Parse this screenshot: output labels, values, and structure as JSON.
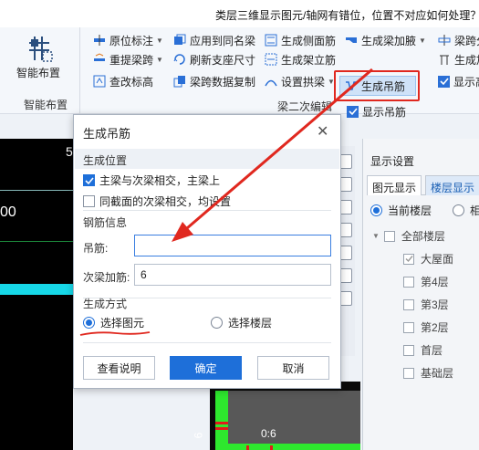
{
  "title_question": "类层三维显示图元/轴网有错位，位置不对应如何处理？",
  "colors": {
    "accent": "#1e6fd9",
    "highlight": "#e0281f",
    "green": "#2ee82e",
    "cyan": "#17d8e8"
  },
  "ribbon": {
    "smart_layout": {
      "label": "智能布置",
      "group_label": "智能布置",
      "icon": "grid-layout-icon"
    },
    "beam_group_label": "梁二次编辑",
    "items": [
      {
        "label": "原位标注",
        "icon": "in-place-annotation-icon",
        "dropdown": true
      },
      {
        "label": "重提梁跨",
        "icon": "re-extract-span-icon",
        "dropdown": true
      },
      {
        "label": "查改标高",
        "icon": "edit-elevation-icon",
        "dropdown": false
      },
      {
        "label": "应用到同名梁",
        "icon": "apply-same-name-icon",
        "dropdown": false
      },
      {
        "label": "刷新支座尺寸",
        "icon": "refresh-support-icon",
        "dropdown": false
      },
      {
        "label": "梁跨数据复制",
        "icon": "copy-span-data-icon",
        "dropdown": false
      },
      {
        "label": "生成侧面筋",
        "icon": "side-rebar-icon",
        "dropdown": false
      },
      {
        "label": "生成架立筋",
        "icon": "erection-rebar-icon",
        "dropdown": false
      },
      {
        "label": "设置拱梁",
        "icon": "arch-beam-icon",
        "dropdown": true
      },
      {
        "label": "生成梁加腋",
        "icon": "haunch-icon",
        "dropdown": true
      },
      {
        "label": "生成吊筋",
        "icon": "hanger-rebar-icon",
        "dropdown": false
      },
      {
        "label": "显示吊筋",
        "icon": "checkbox-checked-icon",
        "dropdown": false
      },
      {
        "label": "梁跨分",
        "icon": "span-split-icon",
        "dropdown": false
      },
      {
        "label": "生成加",
        "icon": "generate-add-icon",
        "dropdown": false
      },
      {
        "label": "显示高",
        "icon": "checkbox-checked-icon",
        "dropdown": false
      }
    ]
  },
  "canvas": {
    "left_number": "00",
    "top_number": "5",
    "dim_label": "0:6",
    "side_label": "6"
  },
  "right_panel": {
    "title": "显示设置",
    "tabs": [
      {
        "label": "图元显示",
        "active": false
      },
      {
        "label": "楼层显示",
        "active": true
      }
    ],
    "radios": [
      {
        "label": "当前楼层",
        "selected": true
      },
      {
        "label": "相",
        "selected": false
      }
    ],
    "tree": [
      {
        "label": "全部楼层",
        "level": 0,
        "checked": false,
        "expandable": true
      },
      {
        "label": "大屋面",
        "level": 1,
        "checked": true
      },
      {
        "label": "第4层",
        "level": 1,
        "checked": false
      },
      {
        "label": "第3层",
        "level": 1,
        "checked": false
      },
      {
        "label": "第2层",
        "level": 1,
        "checked": false
      },
      {
        "label": "首层",
        "level": 1,
        "checked": false
      },
      {
        "label": "基础层",
        "level": 1,
        "checked": false
      }
    ]
  },
  "dialog": {
    "title": "生成吊筋",
    "section_position": "生成位置",
    "options": [
      {
        "label": "主梁与次梁相交，主梁上",
        "checked": true
      },
      {
        "label": "同截面的次梁相交，均设置",
        "checked": false
      }
    ],
    "section_rebar": "钢筋信息",
    "hanger_label": "吊筋:",
    "hanger_value": "",
    "secondary_label": "次梁加筋:",
    "secondary_value": "6",
    "section_method": "生成方式",
    "methods": [
      {
        "label": "选择图元",
        "selected": true
      },
      {
        "label": "选择楼层",
        "selected": false
      }
    ],
    "buttons": {
      "help": "查看说明",
      "ok": "确定",
      "cancel": "取消"
    }
  }
}
